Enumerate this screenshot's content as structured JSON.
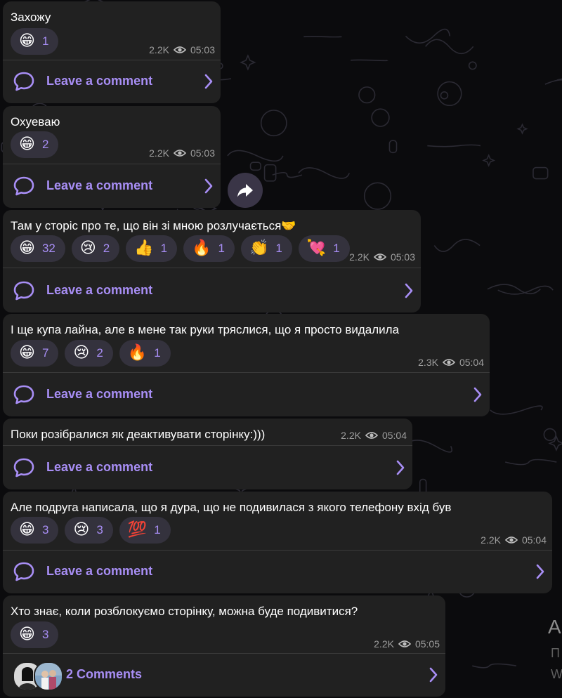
{
  "messages": [
    {
      "text": "Захожу",
      "reactions": [
        {
          "emoji": "😁",
          "count": "1"
        }
      ],
      "views": "2.2K",
      "time": "05:03",
      "comment": {
        "label": "Leave a comment"
      }
    },
    {
      "text": "Охуеваю",
      "reactions": [
        {
          "emoji": "😁",
          "count": "2"
        }
      ],
      "views": "2.2K",
      "time": "05:03",
      "comment": {
        "label": "Leave a comment"
      }
    },
    {
      "text": "Там у сторіс про те, що він зі мною розлучається🤝",
      "reactions": [
        {
          "emoji": "😁",
          "count": "32"
        },
        {
          "emoji": "😢",
          "count": "2"
        },
        {
          "emoji": "👍",
          "count": "1"
        },
        {
          "emoji": "🔥",
          "count": "1"
        },
        {
          "emoji": "👏",
          "count": "1"
        },
        {
          "emoji": "💘",
          "count": "1"
        }
      ],
      "views": "2.2K",
      "time": "05:03",
      "comment": {
        "label": "Leave a comment"
      }
    },
    {
      "text": "І ще купа лайна, але в мене так руки тряслися, що я просто видалила",
      "reactions": [
        {
          "emoji": "😁",
          "count": "7"
        },
        {
          "emoji": "😢",
          "count": "2"
        },
        {
          "emoji": "🔥",
          "count": "1"
        }
      ],
      "views": "2.3K",
      "time": "05:04",
      "comment": {
        "label": "Leave a comment"
      }
    },
    {
      "text": "Поки розібралися як деактивувати сторінку:)))",
      "reactions": [],
      "views": "2.2K",
      "time": "05:04",
      "comment": {
        "label": "Leave a comment"
      }
    },
    {
      "text": "Але подруга написала, що я дура, що не подивилася з якого телефону вхід був",
      "reactions": [
        {
          "emoji": "😁",
          "count": "3"
        },
        {
          "emoji": "😢",
          "count": "3"
        },
        {
          "emoji": "💯",
          "count": "1"
        }
      ],
      "views": "2.2K",
      "time": "05:04",
      "comment": {
        "label": "Leave a comment"
      }
    },
    {
      "text": "Хто знає, коли розблокуємо сторінку, можна буде подивитися?",
      "reactions": [
        {
          "emoji": "😁",
          "count": "3"
        }
      ],
      "views": "2.2K",
      "time": "05:05",
      "comment": {
        "label": "2 Comments"
      }
    }
  ],
  "side_panel": {
    "letter": "A",
    "line1": "П",
    "line2": "W"
  },
  "colors": {
    "accent": "#a88ef5",
    "bubble": "#212121",
    "background": "#0b0b0d"
  }
}
